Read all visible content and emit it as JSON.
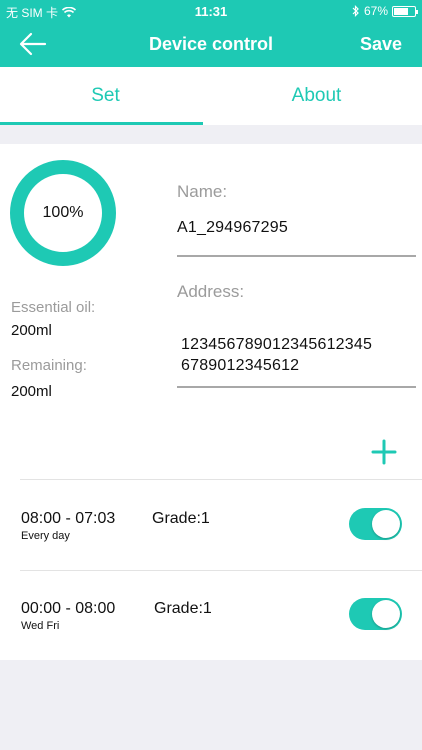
{
  "status_bar": {
    "carrier": "无 SIM 卡",
    "time": "11:31",
    "battery": "67%",
    "battery_level": 0.67,
    "icons": [
      "wifi-icon",
      "bluetooth-icon",
      "battery-icon"
    ]
  },
  "nav": {
    "title": "Device control",
    "save_label": "Save",
    "back_icon": "arrow-left-icon"
  },
  "tabs": [
    {
      "label": "Set",
      "selected": true
    },
    {
      "label": "About",
      "selected": false
    }
  ],
  "device": {
    "oil_percent_label": "100%",
    "oil_level": 1.0,
    "essential_oil_label": "Essential oil:",
    "essential_oil_value": "200ml",
    "remaining_label": "Remaining:",
    "remaining_value": "200ml",
    "name_label": "Name:",
    "name_value": "A1_294967295",
    "address_label": "Address:",
    "address_line1": "12345678901234561234​5",
    "address_line2": "6789012345612"
  },
  "add_icon": "plus-icon",
  "schedules": [
    {
      "time": "08:00 - 07:03",
      "grade": "Grade:1",
      "days": "Every day",
      "enabled": true
    },
    {
      "time": "00:00 - 08:00",
      "grade": "Grade:1",
      "days": "Wed Fri",
      "enabled": true
    }
  ],
  "colors": {
    "accent": "#1ec9b4",
    "background": "#efeff4",
    "card": "#ffffff",
    "label_gray": "#9b9b9b"
  }
}
